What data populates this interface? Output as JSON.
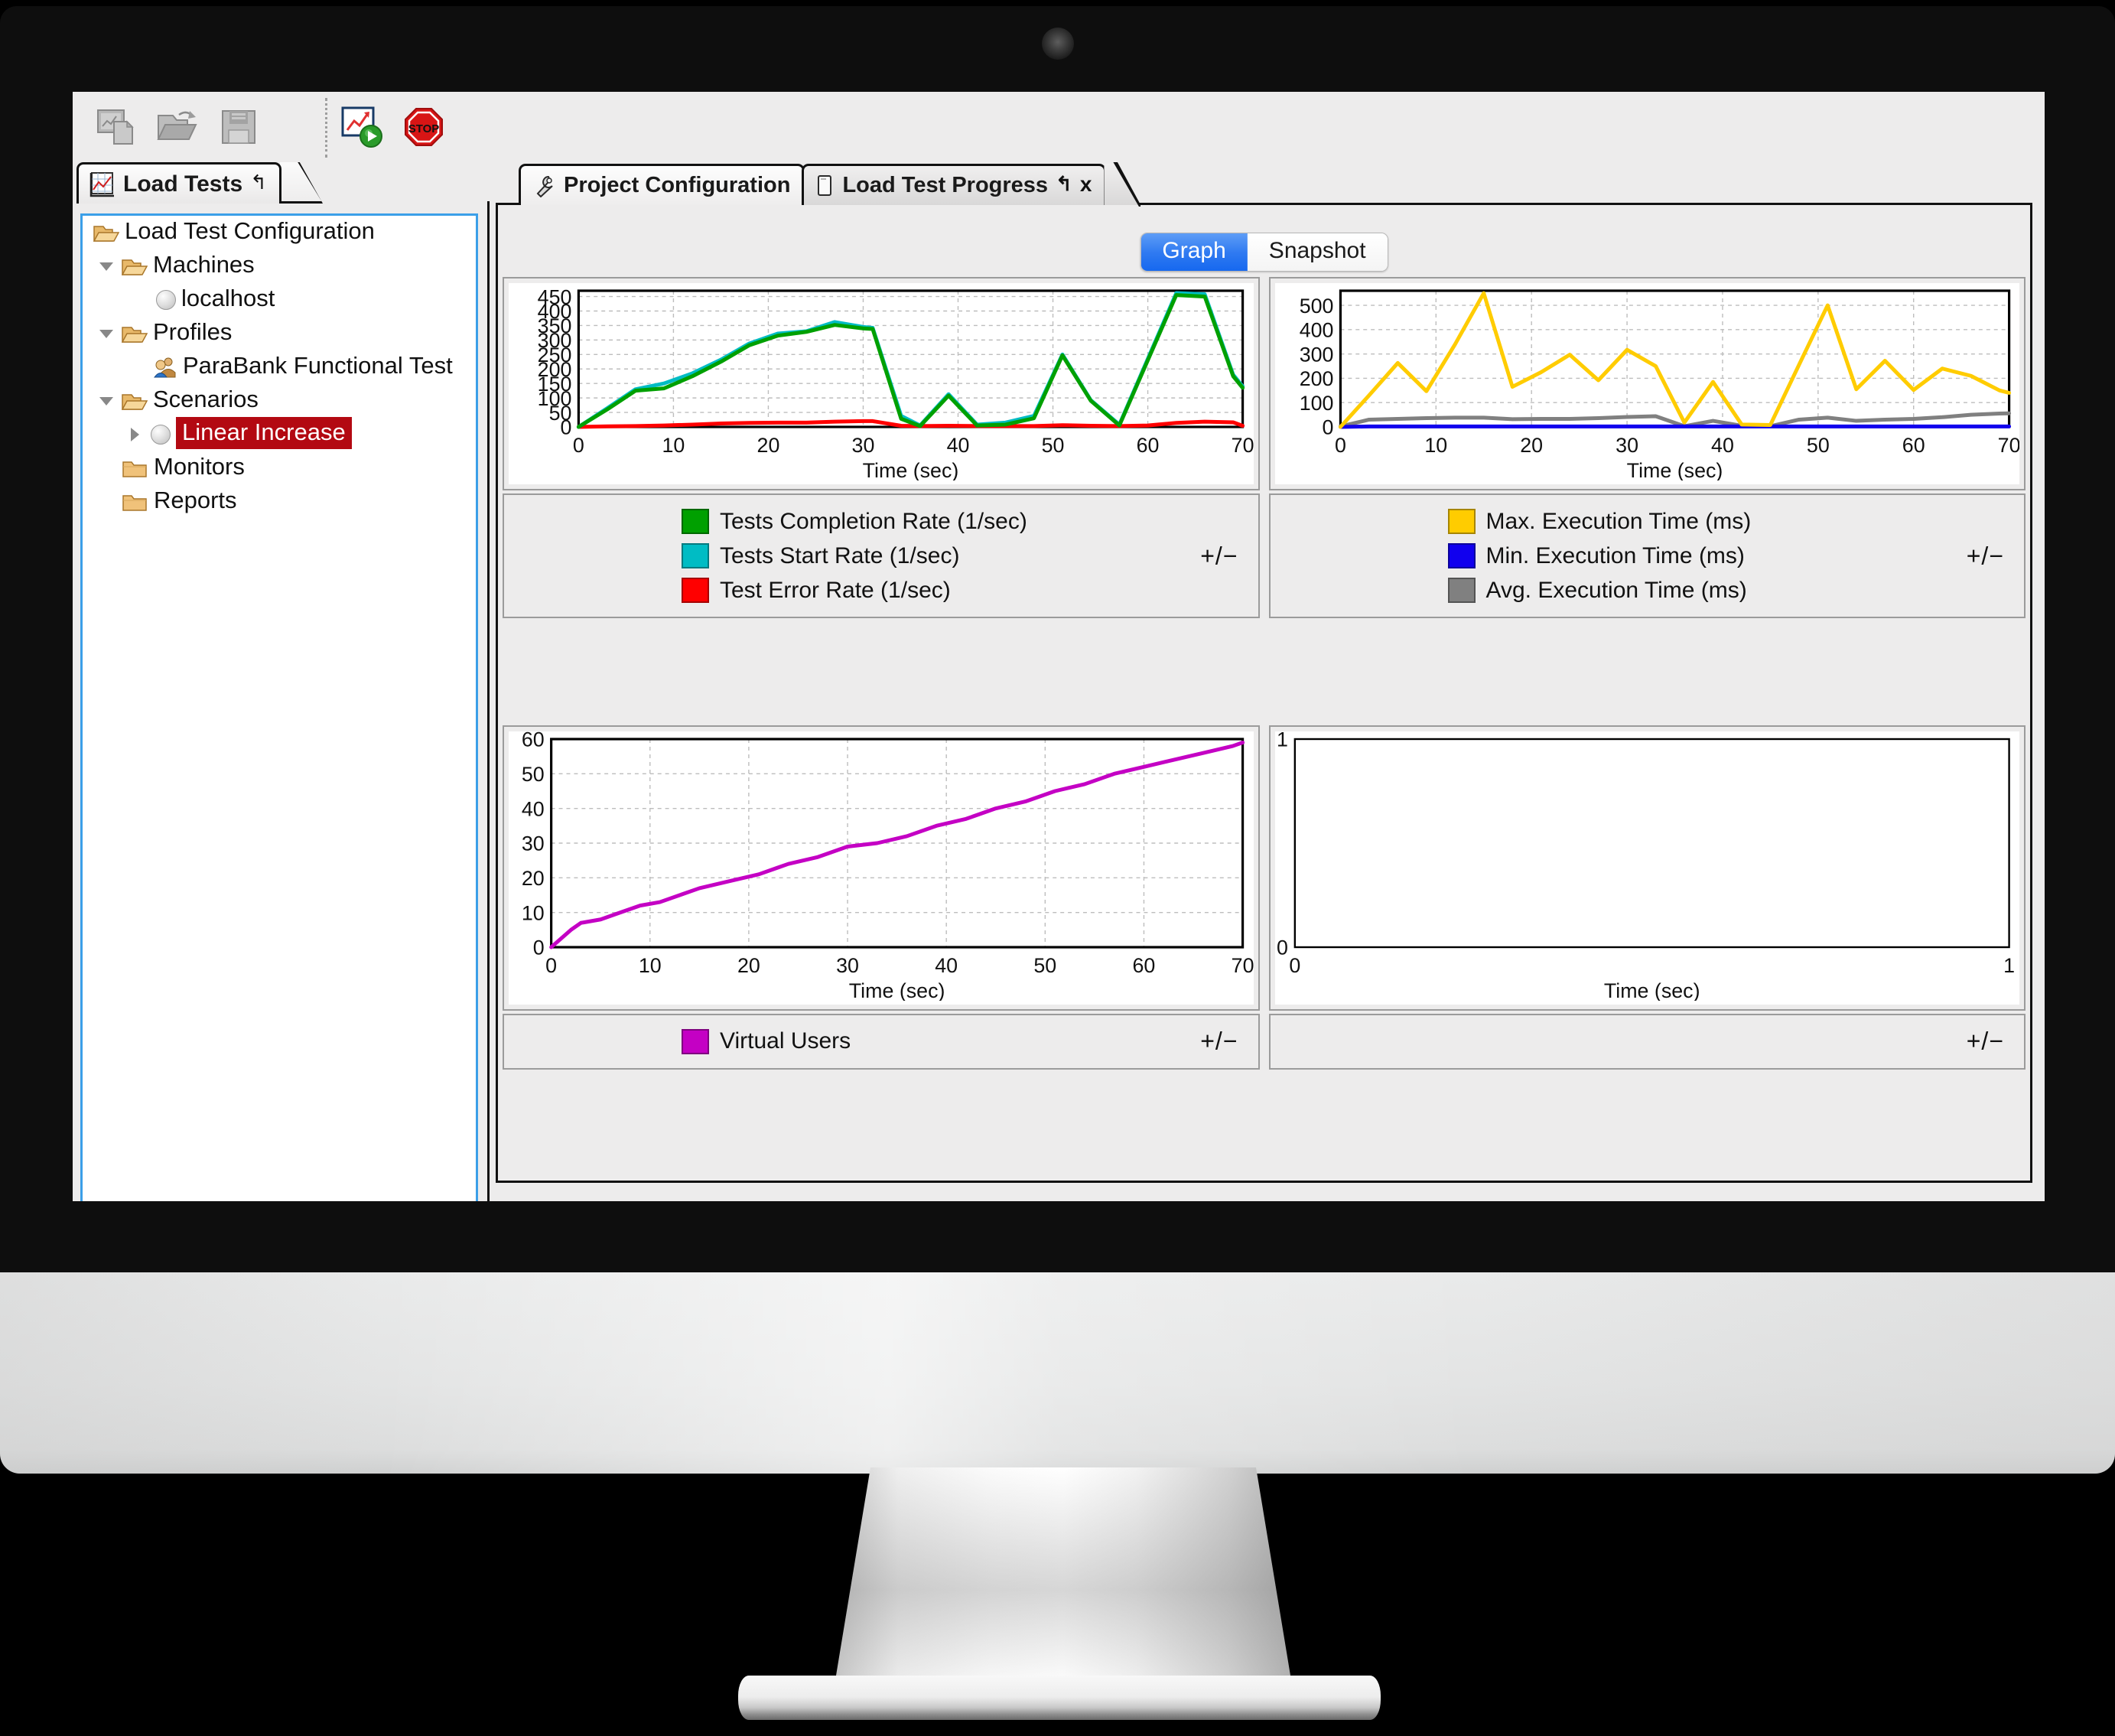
{
  "app": {
    "toolbar": {
      "buttons": [
        {
          "name": "new-load-test",
          "icon": "new-chart-document-icon",
          "enabled": false
        },
        {
          "name": "open-load-test",
          "icon": "open-folder-icon",
          "enabled": false
        },
        {
          "name": "save-load-test",
          "icon": "floppy-save-icon",
          "enabled": false
        },
        {
          "name": "run-load-test",
          "icon": "run-chart-play-icon",
          "enabled": true
        },
        {
          "name": "stop-load-test",
          "icon": "stop-sign-icon",
          "enabled": true
        }
      ]
    },
    "left_tab": {
      "label": "Load Tests",
      "icon": "chart-grid-icon",
      "pin": "↰"
    },
    "tree": {
      "root": {
        "label": "Load Test Configuration",
        "icon": "open-folder-icon"
      },
      "items": [
        {
          "label": "Machines",
          "icon": "open-folder-icon",
          "twisty": "down",
          "indent": 0
        },
        {
          "label": "localhost",
          "icon": "grey-ball-icon",
          "twisty": "none",
          "indent": 1
        },
        {
          "label": "Profiles",
          "icon": "open-folder-icon",
          "twisty": "down",
          "indent": 0
        },
        {
          "label": "ParaBank Functional Test",
          "icon": "users-profile-icon",
          "twisty": "none",
          "indent": 1
        },
        {
          "label": "Scenarios",
          "icon": "open-folder-icon",
          "twisty": "down",
          "indent": 0
        },
        {
          "label": "Linear Increase",
          "icon": "grey-ball-icon",
          "twisty": "right",
          "indent": 1,
          "selected": true
        },
        {
          "label": "Monitors",
          "icon": "closed-folder-icon",
          "twisty": "none",
          "indent": 0
        },
        {
          "label": "Reports",
          "icon": "closed-folder-icon",
          "twisty": "none",
          "indent": 0
        }
      ],
      "selection_color": "#b30912"
    },
    "document_tabs": [
      {
        "label": "Project Configuration",
        "icon": "wrench-icon",
        "active": false,
        "closable": false
      },
      {
        "label": "Load Test Progress",
        "icon": "page-icon",
        "active": true,
        "closable": true,
        "pin": "↰",
        "close": "x"
      }
    ],
    "view_toggle": {
      "options": [
        "Graph",
        "Snapshot"
      ],
      "selected": "Graph",
      "accent": "#2f7af1"
    }
  },
  "chart_data": [
    {
      "id": "tests-rate-chart",
      "type": "line",
      "title": "",
      "xlabel": "Time (sec)",
      "ylabel": "",
      "xlim": [
        0,
        70
      ],
      "ylim": [
        0,
        470
      ],
      "xticks": [
        0,
        10,
        20,
        30,
        40,
        50,
        60,
        70
      ],
      "yticks": [
        0,
        50,
        100,
        150,
        200,
        250,
        300,
        350,
        400,
        450
      ],
      "grid": true,
      "legend_position": "below",
      "legend_toggle": "+/−",
      "series": [
        {
          "name": "Tests Completion Rate (1/sec)",
          "color": "#00a000",
          "x": [
            0,
            3,
            6,
            9,
            12,
            15,
            18,
            21,
            24,
            27,
            30,
            31,
            34,
            36,
            39,
            42,
            45,
            48,
            51,
            54,
            57,
            60,
            63,
            66,
            69,
            70
          ],
          "values": [
            0,
            60,
            125,
            133,
            175,
            225,
            282,
            315,
            328,
            352,
            340,
            338,
            28,
            3,
            108,
            5,
            8,
            30,
            247,
            90,
            5,
            230,
            455,
            450,
            175,
            135
          ]
        },
        {
          "name": "Tests Start Rate (1/sec)",
          "color": "#00bcc4",
          "x": [
            0,
            3,
            6,
            9,
            12,
            15,
            18,
            21,
            24,
            27,
            30,
            31,
            34,
            36,
            39,
            42,
            45,
            48,
            51,
            54,
            57,
            60,
            63,
            66,
            69,
            70
          ],
          "values": [
            0,
            64,
            130,
            150,
            185,
            232,
            288,
            322,
            330,
            362,
            345,
            342,
            38,
            5,
            113,
            8,
            15,
            38,
            250,
            92,
            8,
            235,
            462,
            458,
            180,
            140
          ]
        },
        {
          "name": "Test Error Rate (1/sec)",
          "color": "#ff0000",
          "x": [
            0,
            3,
            6,
            9,
            12,
            15,
            18,
            21,
            24,
            27,
            30,
            31,
            34,
            36,
            39,
            42,
            45,
            48,
            51,
            54,
            57,
            60,
            63,
            66,
            69,
            70
          ],
          "values": [
            0,
            2,
            3,
            5,
            8,
            12,
            14,
            15,
            15,
            18,
            20,
            20,
            4,
            3,
            4,
            3,
            3,
            3,
            6,
            4,
            3,
            5,
            14,
            18,
            16,
            4
          ]
        }
      ]
    },
    {
      "id": "execution-time-chart",
      "type": "line",
      "title": "",
      "xlabel": "Time (sec)",
      "ylabel": "",
      "xlim": [
        0,
        70
      ],
      "ylim": [
        0,
        560
      ],
      "xticks": [
        0,
        10,
        20,
        30,
        40,
        50,
        60,
        70
      ],
      "yticks": [
        0,
        100,
        200,
        300,
        400,
        500
      ],
      "grid": true,
      "legend_position": "below",
      "legend_toggle": "+/−",
      "series": [
        {
          "name": "Max. Execution Time (ms)",
          "color": "#ffcc00",
          "x": [
            0,
            3,
            6,
            9,
            12,
            15,
            18,
            21,
            24,
            27,
            30,
            33,
            36,
            39,
            42,
            45,
            48,
            51,
            54,
            57,
            60,
            63,
            66,
            69,
            70
          ],
          "values": [
            0,
            130,
            263,
            147,
            340,
            550,
            165,
            225,
            297,
            192,
            317,
            250,
            18,
            185,
            10,
            8,
            255,
            500,
            155,
            272,
            152,
            240,
            210,
            150,
            140
          ]
        },
        {
          "name": "Min. Execution Time (ms)",
          "color": "#1100ee",
          "x": [
            0,
            3,
            6,
            9,
            12,
            15,
            18,
            21,
            24,
            27,
            30,
            33,
            36,
            39,
            42,
            45,
            48,
            51,
            54,
            57,
            60,
            63,
            66,
            69,
            70
          ],
          "values": [
            0,
            2,
            2,
            2,
            2,
            2,
            2,
            2,
            2,
            2,
            2,
            2,
            2,
            2,
            2,
            2,
            2,
            2,
            2,
            2,
            2,
            2,
            2,
            2,
            2
          ]
        },
        {
          "name": "Avg. Execution Time (ms)",
          "color": "#808080",
          "x": [
            0,
            3,
            6,
            9,
            12,
            15,
            18,
            21,
            24,
            27,
            30,
            33,
            36,
            39,
            42,
            45,
            48,
            51,
            54,
            57,
            60,
            63,
            66,
            69,
            70
          ],
          "values": [
            2,
            30,
            33,
            36,
            38,
            38,
            32,
            33,
            33,
            36,
            41,
            44,
            3,
            25,
            5,
            3,
            30,
            38,
            25,
            30,
            33,
            40,
            50,
            55,
            56
          ]
        }
      ]
    },
    {
      "id": "virtual-users-chart",
      "type": "line",
      "title": "",
      "xlabel": "Time (sec)",
      "ylabel": "",
      "xlim": [
        0,
        70
      ],
      "ylim": [
        0,
        60
      ],
      "xticks": [
        0,
        10,
        20,
        30,
        40,
        50,
        60,
        70
      ],
      "yticks": [
        0,
        10,
        20,
        30,
        40,
        50,
        60
      ],
      "grid": true,
      "legend_position": "below",
      "legend_toggle": "+/−",
      "series": [
        {
          "name": "Virtual Users",
          "color": "#c400c4",
          "x": [
            0,
            2,
            3,
            5,
            7,
            9,
            11,
            13,
            15,
            18,
            21,
            24,
            27,
            30,
            33,
            36,
            39,
            42,
            45,
            48,
            51,
            54,
            57,
            60,
            63,
            66,
            69,
            70
          ],
          "values": [
            0,
            5,
            7,
            8,
            10,
            12,
            13,
            15,
            17,
            19,
            21,
            24,
            26,
            29,
            30,
            32,
            35,
            37,
            40,
            42,
            45,
            47,
            50,
            52,
            54,
            56,
            58,
            59
          ]
        }
      ]
    },
    {
      "id": "empty-chart",
      "type": "line",
      "title": "",
      "xlabel": "Time (sec)",
      "ylabel": "",
      "xlim": [
        0,
        1
      ],
      "ylim": [
        0,
        1
      ],
      "xticks": [
        0,
        1
      ],
      "yticks": [
        0,
        1
      ],
      "grid": false,
      "legend_position": "below",
      "legend_toggle": "+/−",
      "series": []
    }
  ]
}
